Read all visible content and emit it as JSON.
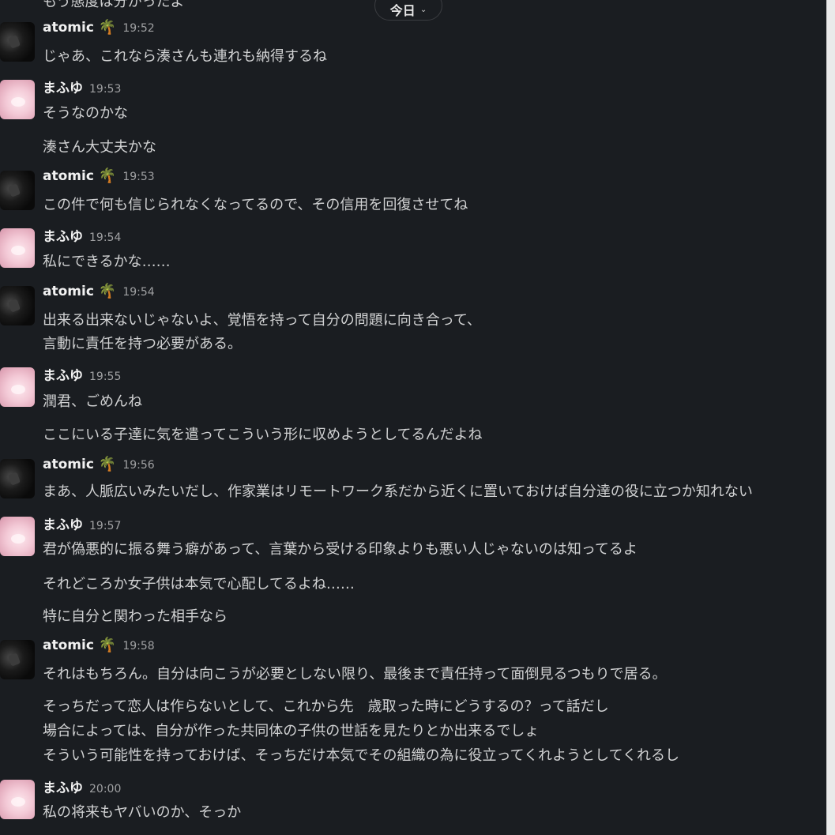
{
  "date_divider": {
    "label": "今日"
  },
  "partial_top_text": "もう態度は分かったよ",
  "messages": [
    {
      "author": "atomic",
      "emoji": "🌴",
      "time": "19:52",
      "lines": [
        "じゃあ、これなら湊さんも連れも納得するね"
      ]
    },
    {
      "author": "まふゆ",
      "emoji": "",
      "time": "19:53",
      "lines": [
        "そうなのかな",
        "湊さん大丈夫かな"
      ]
    },
    {
      "author": "atomic",
      "emoji": "🌴",
      "time": "19:53",
      "lines": [
        "この件で何も信じられなくなってるので、その信用を回復させてね"
      ]
    },
    {
      "author": "まふゆ",
      "emoji": "",
      "time": "19:54",
      "lines": [
        "私にできるかな……"
      ]
    },
    {
      "author": "atomic",
      "emoji": "🌴",
      "time": "19:54",
      "lines": [
        "出来る出来ないじゃないよ、覚悟を持って自分の問題に向き合って、",
        "言動に責任を持つ必要がある。"
      ]
    },
    {
      "author": "まふゆ",
      "emoji": "",
      "time": "19:55",
      "lines": [
        "潤君、ごめんね",
        "ここにいる子達に気を遣ってこういう形に収めようとしてるんだよね"
      ]
    },
    {
      "author": "atomic",
      "emoji": "🌴",
      "time": "19:56",
      "lines": [
        "まあ、人脈広いみたいだし、作家業はリモートワーク系だから近くに置いておけば自分達の役に立つか知れない"
      ]
    },
    {
      "author": "まふゆ",
      "emoji": "",
      "time": "19:57",
      "lines": [
        "君が偽悪的に振る舞う癖があって、言葉から受ける印象よりも悪い人じゃないのは知ってるよ",
        "それどころか女子供は本気で心配してるよね……",
        "特に自分と関わった相手なら"
      ]
    },
    {
      "author": "atomic",
      "emoji": "🌴",
      "time": "19:58",
      "lines": [
        "それはもちろん。自分は向こうが必要としない限り、最後まで責任持って面倒見るつもりで居る。",
        "そっちだって恋人は作らないとして、これから先　歳取った時にどうするの？って話だし",
        "場合によっては、自分が作った共同体の子供の世話を見たりとか出来るでしょ",
        "そういう可能性を持っておけば、そっちだけ本気でその組織の為に役立ってくれようとしてくれるし"
      ]
    },
    {
      "author": "まふゆ",
      "emoji": "",
      "time": "20:00",
      "lines": [
        "私の将来もヤバいのか、そっか"
      ]
    }
  ]
}
